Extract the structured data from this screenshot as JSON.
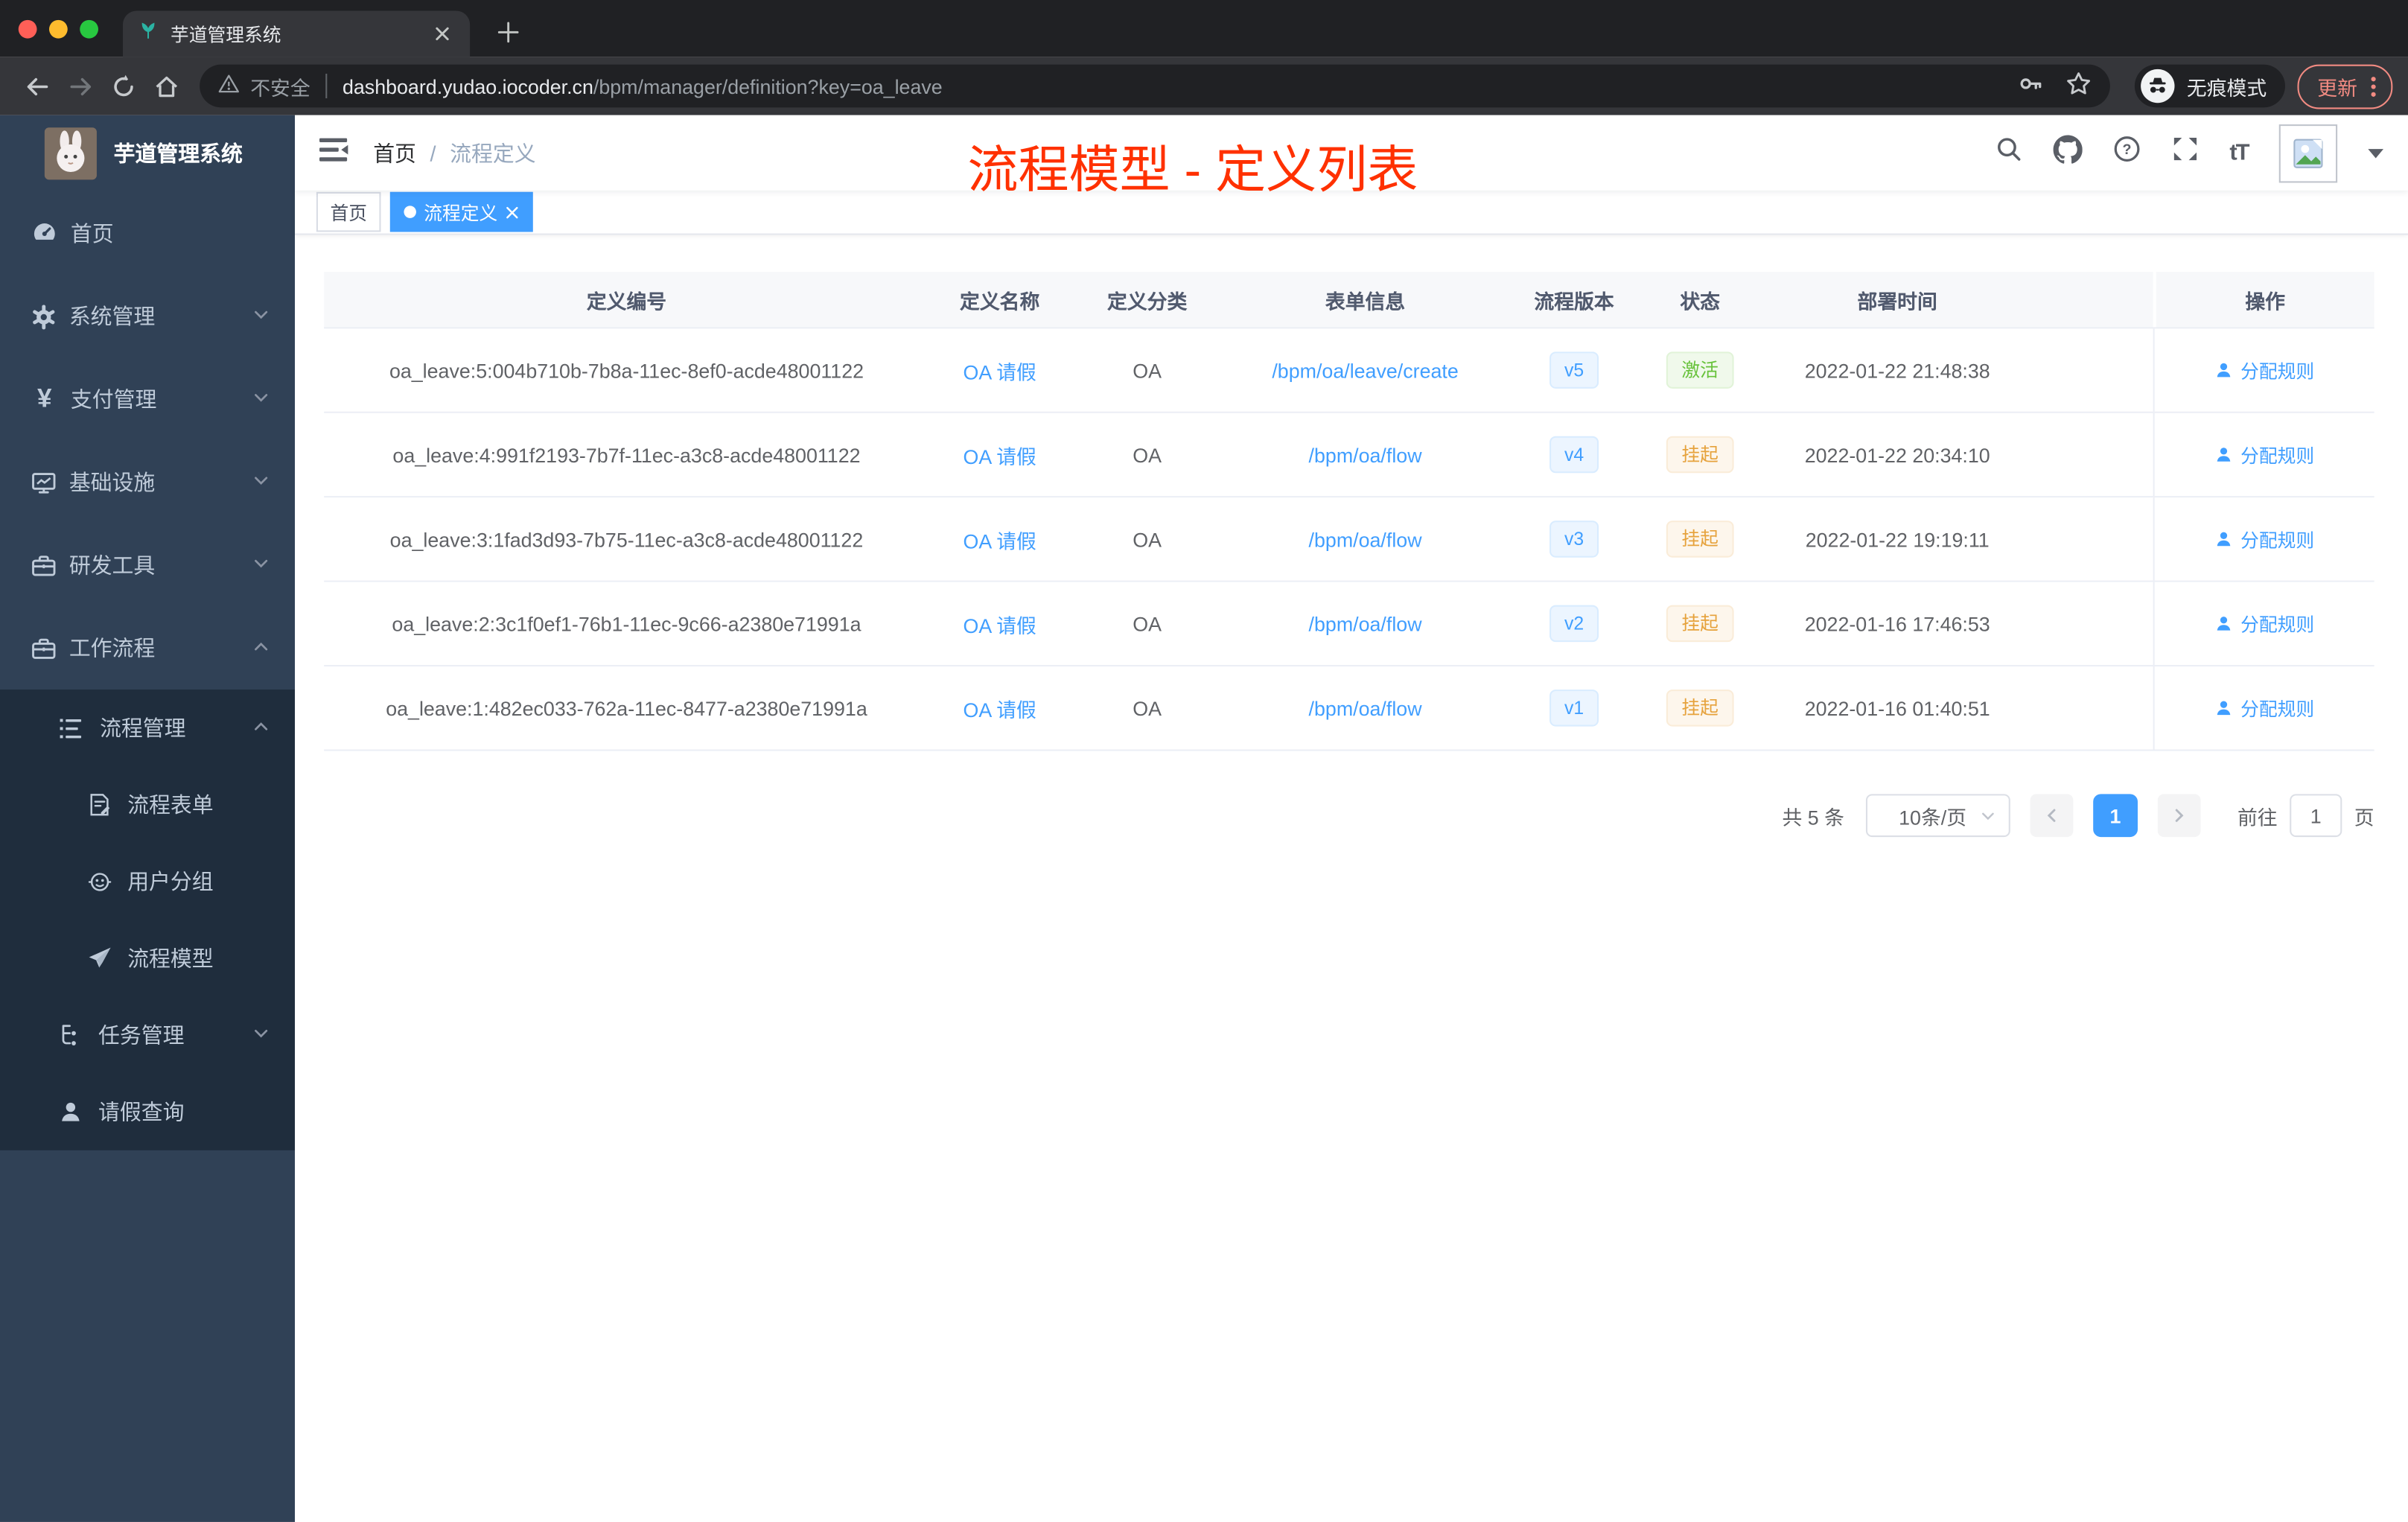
{
  "browser": {
    "tab_title": "芋道管理系统",
    "security_label": "不安全",
    "url_host": "dashboard.yudao.iocoder.cn",
    "url_path": "/bpm/manager/definition?key=oa_leave",
    "incognito_label": "无痕模式",
    "update_label": "更新"
  },
  "app": {
    "annotation": "流程模型 - 定义列表",
    "breadcrumb": {
      "home": "首页",
      "separator": "/",
      "current": "流程定义"
    },
    "tags": {
      "home": "首页",
      "current": "流程定义"
    },
    "font_size_icon": "tT",
    "payment_icon": "¥"
  },
  "sidebar": {
    "title": "芋道管理系统",
    "items": [
      {
        "label": "首页"
      },
      {
        "label": "系统管理"
      },
      {
        "label": "支付管理"
      },
      {
        "label": "基础设施"
      },
      {
        "label": "研发工具"
      },
      {
        "label": "工作流程"
      },
      {
        "label": "流程管理"
      },
      {
        "label": "流程表单"
      },
      {
        "label": "用户分组"
      },
      {
        "label": "流程模型"
      },
      {
        "label": "任务管理"
      },
      {
        "label": "请假查询"
      }
    ]
  },
  "table": {
    "headers": [
      "定义编号",
      "定义名称",
      "定义分类",
      "表单信息",
      "流程版本",
      "状态",
      "部署时间",
      "操作"
    ],
    "rows": [
      {
        "id": "oa_leave:5:004b710b-7b8a-11ec-8ef0-acde48001122",
        "name": "OA 请假",
        "category": "OA",
        "form": "/bpm/oa/leave/create",
        "version": "v5",
        "status": "激活",
        "deploy_time": "2022-01-22 21:48:38",
        "action": "分配规则"
      },
      {
        "id": "oa_leave:4:991f2193-7b7f-11ec-a3c8-acde48001122",
        "name": "OA 请假",
        "category": "OA",
        "form": "/bpm/oa/flow",
        "version": "v4",
        "status": "挂起",
        "deploy_time": "2022-01-22 20:34:10",
        "action": "分配规则"
      },
      {
        "id": "oa_leave:3:1fad3d93-7b75-11ec-a3c8-acde48001122",
        "name": "OA 请假",
        "category": "OA",
        "form": "/bpm/oa/flow",
        "version": "v3",
        "status": "挂起",
        "deploy_time": "2022-01-22 19:19:11",
        "action": "分配规则"
      },
      {
        "id": "oa_leave:2:3c1f0ef1-76b1-11ec-9c66-a2380e71991a",
        "name": "OA 请假",
        "category": "OA",
        "form": "/bpm/oa/flow",
        "version": "v2",
        "status": "挂起",
        "deploy_time": "2022-01-16 17:46:53",
        "action": "分配规则"
      },
      {
        "id": "oa_leave:1:482ec033-762a-11ec-8477-a2380e71991a",
        "name": "OA 请假",
        "category": "OA",
        "form": "/bpm/oa/flow",
        "version": "v1",
        "status": "挂起",
        "deploy_time": "2022-01-16 01:40:51",
        "action": "分配规则"
      }
    ]
  },
  "pagination": {
    "total": "共 5 条",
    "page_size": "10条/页",
    "page": "1",
    "goto_label": "前往",
    "goto_value": "1",
    "unit": "页"
  },
  "colors": {
    "accent": "#409eff",
    "annotation": "#ff3100",
    "success_text": "#67c23a",
    "warning_text": "#e6a23c",
    "sidebar_bg": "#304156",
    "submenu_bg": "#1f2d3d"
  }
}
